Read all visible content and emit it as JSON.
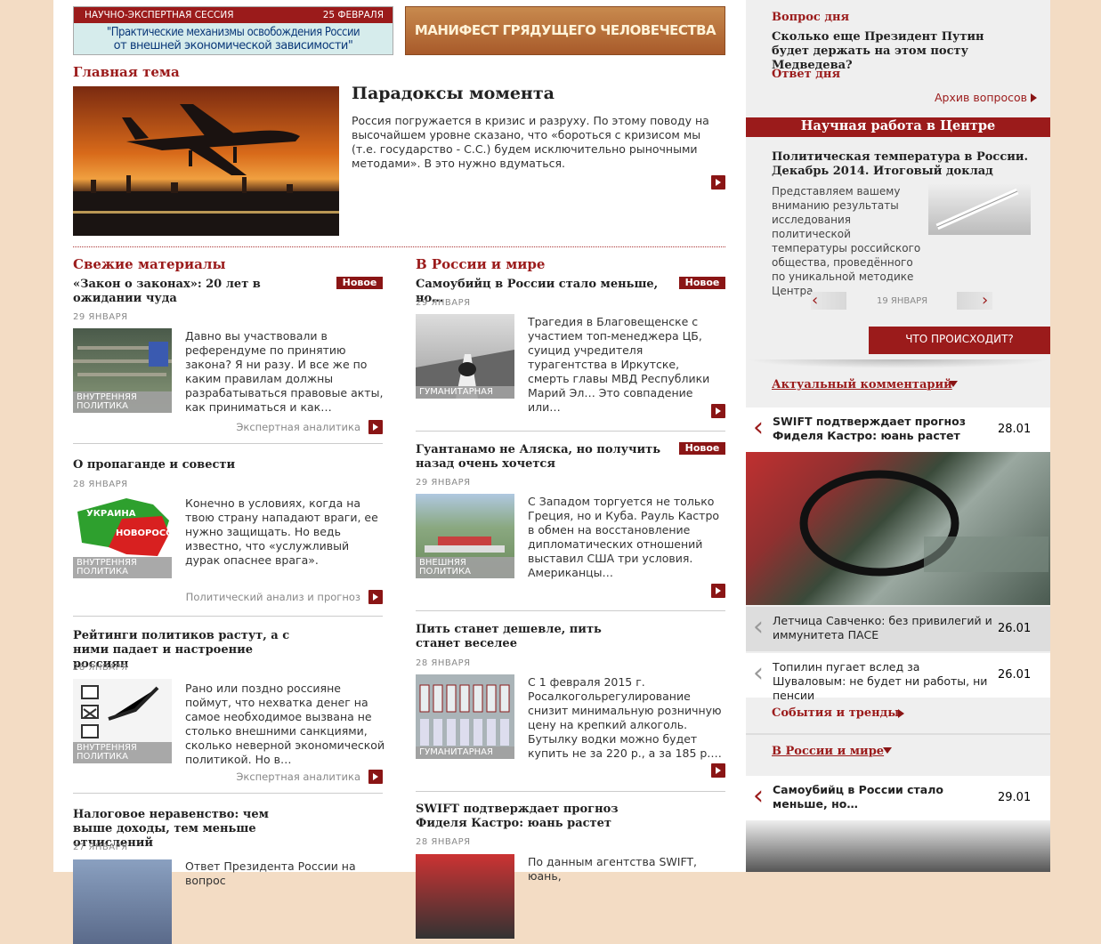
{
  "banners": {
    "session": {
      "top_left": "НАУЧНО-ЭКСПЕРТНАЯ СЕССИЯ",
      "top_right": "25 ФЕВРАЛЯ",
      "line1": "\"Практические механизмы освобождения России",
      "line2": "от внешней экономической зависимости\""
    },
    "manifest": "МАНИФЕСТ ГРЯДУЩЕГО ЧЕЛОВЕЧЕСТВА"
  },
  "main_theme": {
    "section": "Главная тема",
    "title": "Парадоксы момента",
    "text": "Россия погружается в кризис и разруху. По этому поводу на высочайшем уровне сказано, что «бороться с кризисом мы (т.е. государство - С.С.) будем исключительно рыночными методами». В это нужно вдуматься."
  },
  "fresh": {
    "section": "Свежие материалы",
    "items": [
      {
        "title": "«Закон о законах»: 20 лет в ожидании чуда",
        "badge": "Новое",
        "date": "29 ЯНВАРЯ",
        "tag": "ВНУТРЕННЯЯ ПОЛИТИКА",
        "text": "Давно вы участвовали в референдуме по принятию закона? Я ни разу. И все же по каким правилам должны разрабатываться правовые акты, как приниматься и как…",
        "rubric": "Экспертная аналитика"
      },
      {
        "title": "О пропаганде и совести",
        "date": "28 ЯНВАРЯ",
        "tag": "ВНУТРЕННЯЯ ПОЛИТИКА",
        "text": "Конечно в условиях, когда на твою страну нападают враги, ее нужно защищать. Но ведь известно, что «услужливый дурак опаснее врага».",
        "rubric": "Политический анализ и прогноз",
        "map_label1": "УКРАИНА",
        "map_label2": "НОВОРОССИЯ"
      },
      {
        "title": "Рейтинги политиков растут, а с ними падает и настроение россиян",
        "date": "28 ЯНВАРЯ",
        "tag": "ВНУТРЕННЯЯ ПОЛИТИКА",
        "text": "Рано или поздно россияне поймут, что нехватка денег на самое необходимое вызвана не столько внешними санкциями, сколько неверной экономической политикой. Но в…",
        "rubric": "Экспертная аналитика"
      },
      {
        "title": "Налоговое неравенство: чем выше доходы, тем меньше отчислений",
        "date": "27 ЯНВАРЯ",
        "text": "Ответ Президента России на вопрос"
      }
    ]
  },
  "world": {
    "section": "В России и мире",
    "items": [
      {
        "title": "Самоубийц в России стало меньше, но…",
        "badge": "Новое",
        "date": "29 ЯНВАРЯ",
        "tag": "ГУМАНИТАРНАЯ",
        "text": "Трагедия в Благовещенске с участием топ-менеджера ЦБ, суицид учредителя турагентства в Иркутске, смерть главы МВД Республики Марий Эл… Это совпадение или…"
      },
      {
        "title": "Гуантанамо не Аляска, но получить назад очень хочется",
        "badge": "Новое",
        "date": "29 ЯНВАРЯ",
        "tag": "ВНЕШНЯЯ ПОЛИТИКА",
        "text": "С Западом торгуется не только Греция, но и Куба. Рауль Кастро в обмен на восстановление дипломатических отношений выставил США три условия. Американцы…"
      },
      {
        "title": "Пить станет дешевле, пить станет веселее",
        "date": "28 ЯНВАРЯ",
        "tag": "ГУМАНИТАРНАЯ",
        "text": "С 1 февраля 2015 г. Росалкогольрегулирование снизит минимальную розничную цену на крепкий алкоголь. Бутылку водки можно будет купить не за 220 р., а за 185 р.…"
      },
      {
        "title": "SWIFT подтверждает прогноз Фиделя Кастро: юань растет",
        "date": "28 ЯНВАРЯ",
        "text": "По данным агентства SWIFT, юань,"
      }
    ]
  },
  "right": {
    "question_label": "Вопрос дня",
    "question": "Сколько еще Президент Путин будет держать на этом посту Медведева?",
    "answer_label": "Ответ дня",
    "archive": "Архив вопросов",
    "science_head": "Научная работа в Центре",
    "science_title": "Политическая температура в России. Декабрь 2014. Итоговый доклад",
    "science_text": "Представляем вашему вниманию результаты исследования политической температуры российского общества, проведённого по уникальной методике Центра…",
    "slider_date": "19 ЯНВАРЯ",
    "what_btn": "ЧТО ПРОИСХОДИТ?",
    "actual_comment": "Актуальный комментарий",
    "comments": [
      {
        "text": "SWIFT подтверждает прогноз Фиделя Кастро: юань растет",
        "date": "28.01"
      },
      {
        "text": "Летчица Савченко: без привилегий и иммунитета ПАСЕ",
        "date": "26.01"
      },
      {
        "text": "Топилин пугает вслед за Шуваловым: не будет ни работы, ни пенсии",
        "date": "26.01"
      }
    ],
    "events": "События и тренды",
    "russia_world": "В России и мире",
    "comments2": [
      {
        "text": "Самоубийц в России стало меньше, но…",
        "date": "29.01"
      }
    ]
  }
}
